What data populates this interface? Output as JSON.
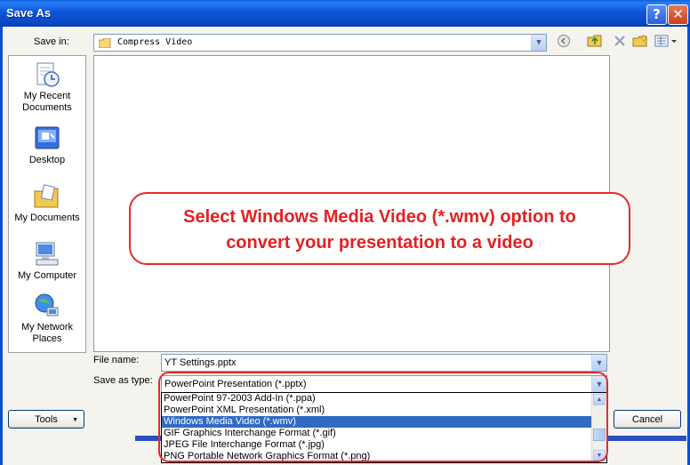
{
  "window": {
    "title": "Save As",
    "help_glyph": "?",
    "close_glyph": "✕"
  },
  "save_in": {
    "label": "Save in:",
    "value": "Compress Video"
  },
  "toolbar": {
    "icons": [
      "back-icon",
      "up-folder-icon",
      "delete-icon",
      "new-folder-icon",
      "views-icon"
    ]
  },
  "places": [
    {
      "label": "My Recent Documents",
      "icon": "recent-documents-icon"
    },
    {
      "label": "Desktop",
      "icon": "desktop-icon"
    },
    {
      "label": "My Documents",
      "icon": "my-documents-icon"
    },
    {
      "label": "My Computer",
      "icon": "my-computer-icon"
    },
    {
      "label": "My Network Places",
      "icon": "network-places-icon"
    }
  ],
  "callout": {
    "line1": "Select Windows Media Video (*.wmv) option to",
    "line2": "convert your presentation to a video",
    "color": "#e32b2b"
  },
  "file_name": {
    "label": "File name:",
    "value": "YT Settings.pptx"
  },
  "save_as_type": {
    "label": "Save as type:",
    "value": "PowerPoint Presentation (*.pptx)",
    "options": [
      "PowerPoint 97-2003 Add-In (*.ppa)",
      "PowerPoint XML Presentation (*.xml)",
      "Windows Media Video (*.wmv)",
      "GIF Graphics Interchange Format (*.gif)",
      "JPEG File Interchange Format (*.jpg)",
      "PNG Portable Network Graphics Format (*.png)"
    ],
    "selected_index": 2
  },
  "buttons": {
    "tools": "Tools",
    "cancel": "Cancel"
  },
  "colors": {
    "titlebar": "#0a56d8",
    "selection": "#316ac5"
  }
}
